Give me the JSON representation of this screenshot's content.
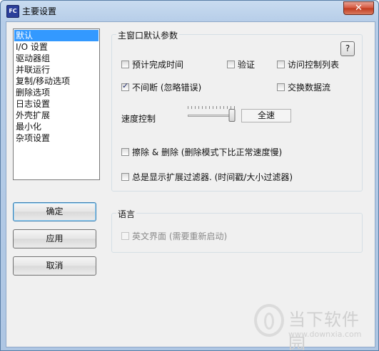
{
  "window": {
    "title": "主要设置",
    "icon_text": "FC",
    "close_symbol": "✕"
  },
  "sidebar": {
    "items": [
      {
        "label": "默认",
        "selected": true
      },
      {
        "label": "I/O 设置"
      },
      {
        "label": "驱动器组"
      },
      {
        "label": "并联运行"
      },
      {
        "label": "复制/移动选项"
      },
      {
        "label": "删除选项"
      },
      {
        "label": "日志设置"
      },
      {
        "label": "外壳扩展"
      },
      {
        "label": "最小化"
      },
      {
        "label": "杂项设置"
      }
    ]
  },
  "buttons": {
    "ok": "确定",
    "apply": "应用",
    "cancel": "取消",
    "help": "?"
  },
  "main_group": {
    "title": "主窗口默认参数",
    "options": {
      "estimate_time": {
        "label": "预计完成时间",
        "checked": false
      },
      "verify": {
        "label": "验证",
        "checked": false
      },
      "acl": {
        "label": "访问控制列表",
        "checked": false
      },
      "no_interrupt": {
        "label": "不间断 (忽略错误)",
        "checked": true
      },
      "alt_streams": {
        "label": "交换数据流",
        "checked": false
      },
      "wipe_delete": {
        "label": "擦除 & 删除 (删除模式下比正常速度慢)",
        "checked": false
      },
      "show_filters": {
        "label": "总是显示扩展过滤器. (时间戳/大小过滤器)",
        "checked": false
      }
    },
    "speed": {
      "label": "速度控制",
      "value_label": "全速",
      "level": 1.0
    }
  },
  "language_group": {
    "title": "语言",
    "english_ui": {
      "label": "英文界面 (需要重新启动)",
      "checked": false,
      "disabled": true
    }
  },
  "watermark": {
    "title": "当下软件园",
    "url": "www.downxia.com"
  },
  "colors": {
    "selection": "#3399ff",
    "titlebar": "#b6cde8",
    "close_button": "#c03a1e"
  }
}
